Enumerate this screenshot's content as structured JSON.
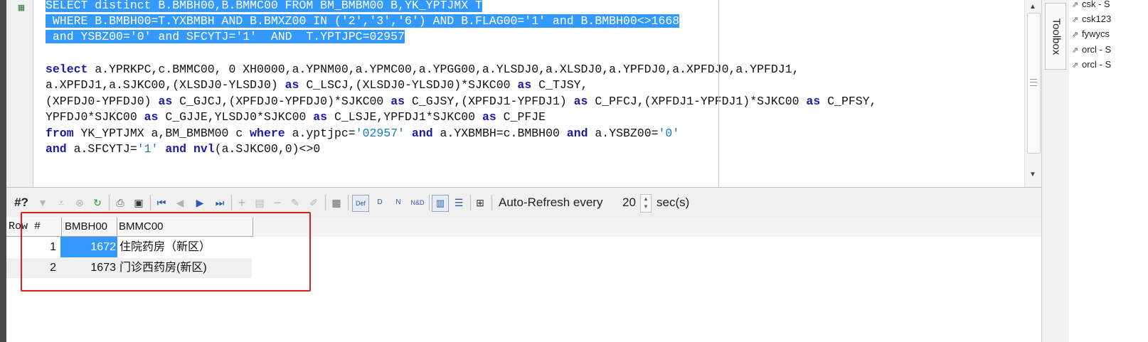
{
  "editor": {
    "selected_lines": [
      "SELECT distinct B.BMBH00,B.BMMC00 FROM BM_BMBM00 B,YK_YPTJMX T",
      " WHERE B.BMBH00=T.YXBMBH AND B.BMXZ00 IN ('2','3','6') AND B.FLAG00='1' and B.BMBH00<>1668",
      " and YSBZ00='0' and SFCYTJ='1'  AND  T.YPTJPC=02957"
    ],
    "code_lines": [
      [
        [
          "kw",
          "select"
        ],
        [
          "t",
          " a.YPRKPC,c.BMMC00, 0 XH0000,a.YPNM00,a.YPMC00,a.YPGG00,a.YLSDJ0,a.XLSDJ0,a.YPFDJ0,a.XPFDJ0,a.YPFDJ1,"
        ]
      ],
      [
        [
          "t",
          "a.XPFDJ1,a.SJKC00,(XLSDJ0-YLSDJ0) "
        ],
        [
          "kw",
          "as"
        ],
        [
          "t",
          " C_LSCJ,(XLSDJ0-YLSDJ0)*SJKC00 "
        ],
        [
          "kw",
          "as"
        ],
        [
          "t",
          " C_TJSY,"
        ]
      ],
      [
        [
          "t",
          "(XPFDJ0-YPFDJ0) "
        ],
        [
          "kw",
          "as"
        ],
        [
          "t",
          " C_GJCJ,(XPFDJ0-YPFDJ0)*SJKC00 "
        ],
        [
          "kw",
          "as"
        ],
        [
          "t",
          " C_GJSY,(XPFDJ1-YPFDJ1) "
        ],
        [
          "kw",
          "as"
        ],
        [
          "t",
          " C_PFCJ,(XPFDJ1-YPFDJ1)*SJKC00 "
        ],
        [
          "kw",
          "as"
        ],
        [
          "t",
          " C_PFSY,"
        ]
      ],
      [
        [
          "t",
          "YPFDJ0*SJKC00 "
        ],
        [
          "kw",
          "as"
        ],
        [
          "t",
          " C_GJJE,YLSDJ0*SJKC00 "
        ],
        [
          "kw",
          "as"
        ],
        [
          "t",
          " C_LSJE,YPFDJ1*SJKC00 "
        ],
        [
          "kw",
          "as"
        ],
        [
          "t",
          " C_PFJE"
        ]
      ],
      [
        [
          "kw",
          "from"
        ],
        [
          "t",
          " YK_YPTJMX a,BM_BMBM00 c "
        ],
        [
          "kw",
          "where"
        ],
        [
          "t",
          " a.yptjpc="
        ],
        [
          "str",
          "'02957'"
        ],
        [
          "t",
          " "
        ],
        [
          "kw",
          "and"
        ],
        [
          "t",
          " a.YXBMBH=c.BMBH00 "
        ],
        [
          "kw",
          "and"
        ],
        [
          "t",
          " a.YSBZ00="
        ],
        [
          "str",
          "'0'"
        ]
      ],
      [
        [
          "kw",
          "and"
        ],
        [
          "t",
          " a.SFCYTJ="
        ],
        [
          "str",
          "'1'"
        ],
        [
          "t",
          " "
        ],
        [
          "kw",
          "and"
        ],
        [
          "t",
          " "
        ],
        [
          "kw",
          "nvl"
        ],
        [
          "t",
          "(a.SJKC00,0)<>0"
        ]
      ]
    ]
  },
  "toolbox": {
    "label": "Toolbox"
  },
  "connections": [
    "csk - S",
    "csk123",
    "fywycs",
    "orcl - S",
    "orcl - S"
  ],
  "toolbar": {
    "hash_label": "#?",
    "auto_refresh_label": "Auto-Refresh every",
    "refresh_value": "20",
    "refresh_unit": "sec(s)",
    "def_label": "Def",
    "d_label": "D",
    "n_label": "N",
    "nd_label": "N&D"
  },
  "grid": {
    "columns": [
      "Row #",
      "BMBH00",
      "BMMC00"
    ],
    "rows": [
      {
        "row": "1",
        "bmbh00": "1672",
        "bmmc00": "住院药房（新区）"
      },
      {
        "row": "2",
        "bmbh00": "1673",
        "bmmc00": "门诊西药房(新区)"
      }
    ]
  },
  "colors": {
    "selection": "#3399ff",
    "keyword": "#1a1aa6",
    "string": "#1a7bb0",
    "annotation": "#e31c1c"
  }
}
